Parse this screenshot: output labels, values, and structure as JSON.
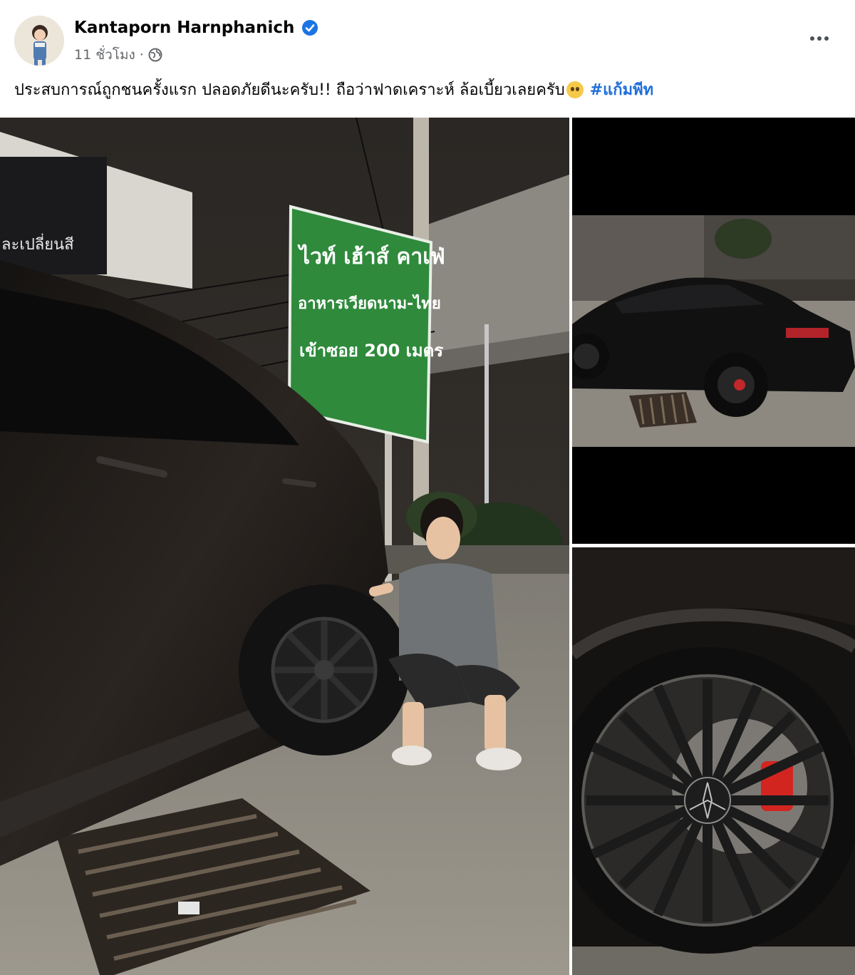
{
  "post": {
    "author": "Kantaporn Harnphanich",
    "time": "11 ชั่วโมง",
    "separator": "·",
    "caption_text": "ประสบการณ์ถูกชนครั้งแรก ปลอดภัยดีนะครับ!! ถือว่าฟาดเคราะห์ ล้อเบี้ยวเลยครับ",
    "hashtag": "#แก้มพีท",
    "icons": {
      "verified": "verified-badge-icon",
      "privacy": "globe-icon",
      "more": "more-options-icon",
      "emoji": "pleading-face-emoji"
    },
    "colors": {
      "author": "#050505",
      "meta": "#65676b",
      "hashtag": "#216fdb",
      "verified": "#1b74e4"
    }
  },
  "photos": {
    "sign": {
      "line1": "ไวท์ เฮ้าส์ คาเฟ่",
      "line2": "อาหารเวียดนาม-ไทย",
      "line3": "เข้าซอย 200 เมตร"
    },
    "building_text": "ละเปลี่ยนสี"
  }
}
